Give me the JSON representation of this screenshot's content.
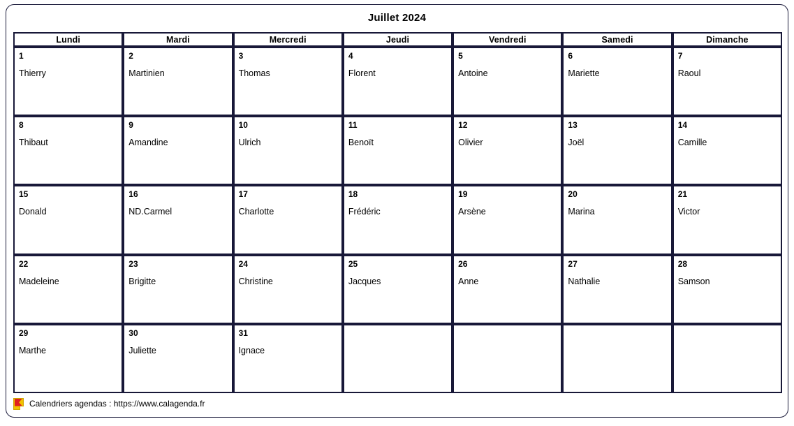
{
  "calendar": {
    "title": "Juillet 2024",
    "weekday_headers": [
      "Lundi",
      "Mardi",
      "Mercredi",
      "Jeudi",
      "Vendredi",
      "Samedi",
      "Dimanche"
    ],
    "weeks": [
      [
        {
          "day": "1",
          "name": "Thierry"
        },
        {
          "day": "2",
          "name": "Martinien"
        },
        {
          "day": "3",
          "name": "Thomas"
        },
        {
          "day": "4",
          "name": "Florent"
        },
        {
          "day": "5",
          "name": "Antoine"
        },
        {
          "day": "6",
          "name": "Mariette"
        },
        {
          "day": "7",
          "name": "Raoul"
        }
      ],
      [
        {
          "day": "8",
          "name": "Thibaut"
        },
        {
          "day": "9",
          "name": "Amandine"
        },
        {
          "day": "10",
          "name": "Ulrich"
        },
        {
          "day": "11",
          "name": "Benoït"
        },
        {
          "day": "12",
          "name": "Olivier"
        },
        {
          "day": "13",
          "name": "Joël"
        },
        {
          "day": "14",
          "name": "Camille"
        }
      ],
      [
        {
          "day": "15",
          "name": "Donald"
        },
        {
          "day": "16",
          "name": "ND.Carmel"
        },
        {
          "day": "17",
          "name": "Charlotte"
        },
        {
          "day": "18",
          "name": "Frédéric"
        },
        {
          "day": "19",
          "name": "Arsène"
        },
        {
          "day": "20",
          "name": "Marina"
        },
        {
          "day": "21",
          "name": "Victor"
        }
      ],
      [
        {
          "day": "22",
          "name": "Madeleine"
        },
        {
          "day": "23",
          "name": "Brigitte"
        },
        {
          "day": "24",
          "name": "Christine"
        },
        {
          "day": "25",
          "name": "Jacques"
        },
        {
          "day": "26",
          "name": "Anne"
        },
        {
          "day": "27",
          "name": "Nathalie"
        },
        {
          "day": "28",
          "name": "Samson"
        }
      ],
      [
        {
          "day": "29",
          "name": "Marthe"
        },
        {
          "day": "30",
          "name": "Juliette"
        },
        {
          "day": "31",
          "name": "Ignace"
        },
        {
          "day": "",
          "name": ""
        },
        {
          "day": "",
          "name": ""
        },
        {
          "day": "",
          "name": ""
        },
        {
          "day": "",
          "name": ""
        }
      ]
    ]
  },
  "footer": {
    "text": "Calendriers agendas : https://www.calagenda.fr",
    "logo_icon": "calendar-flag-icon"
  },
  "colors": {
    "border": "#181838",
    "frame": "#1a1a3a",
    "background": "#ffffff",
    "text": "#000000",
    "logo_red": "#e02020",
    "logo_yellow": "#f2c200"
  }
}
